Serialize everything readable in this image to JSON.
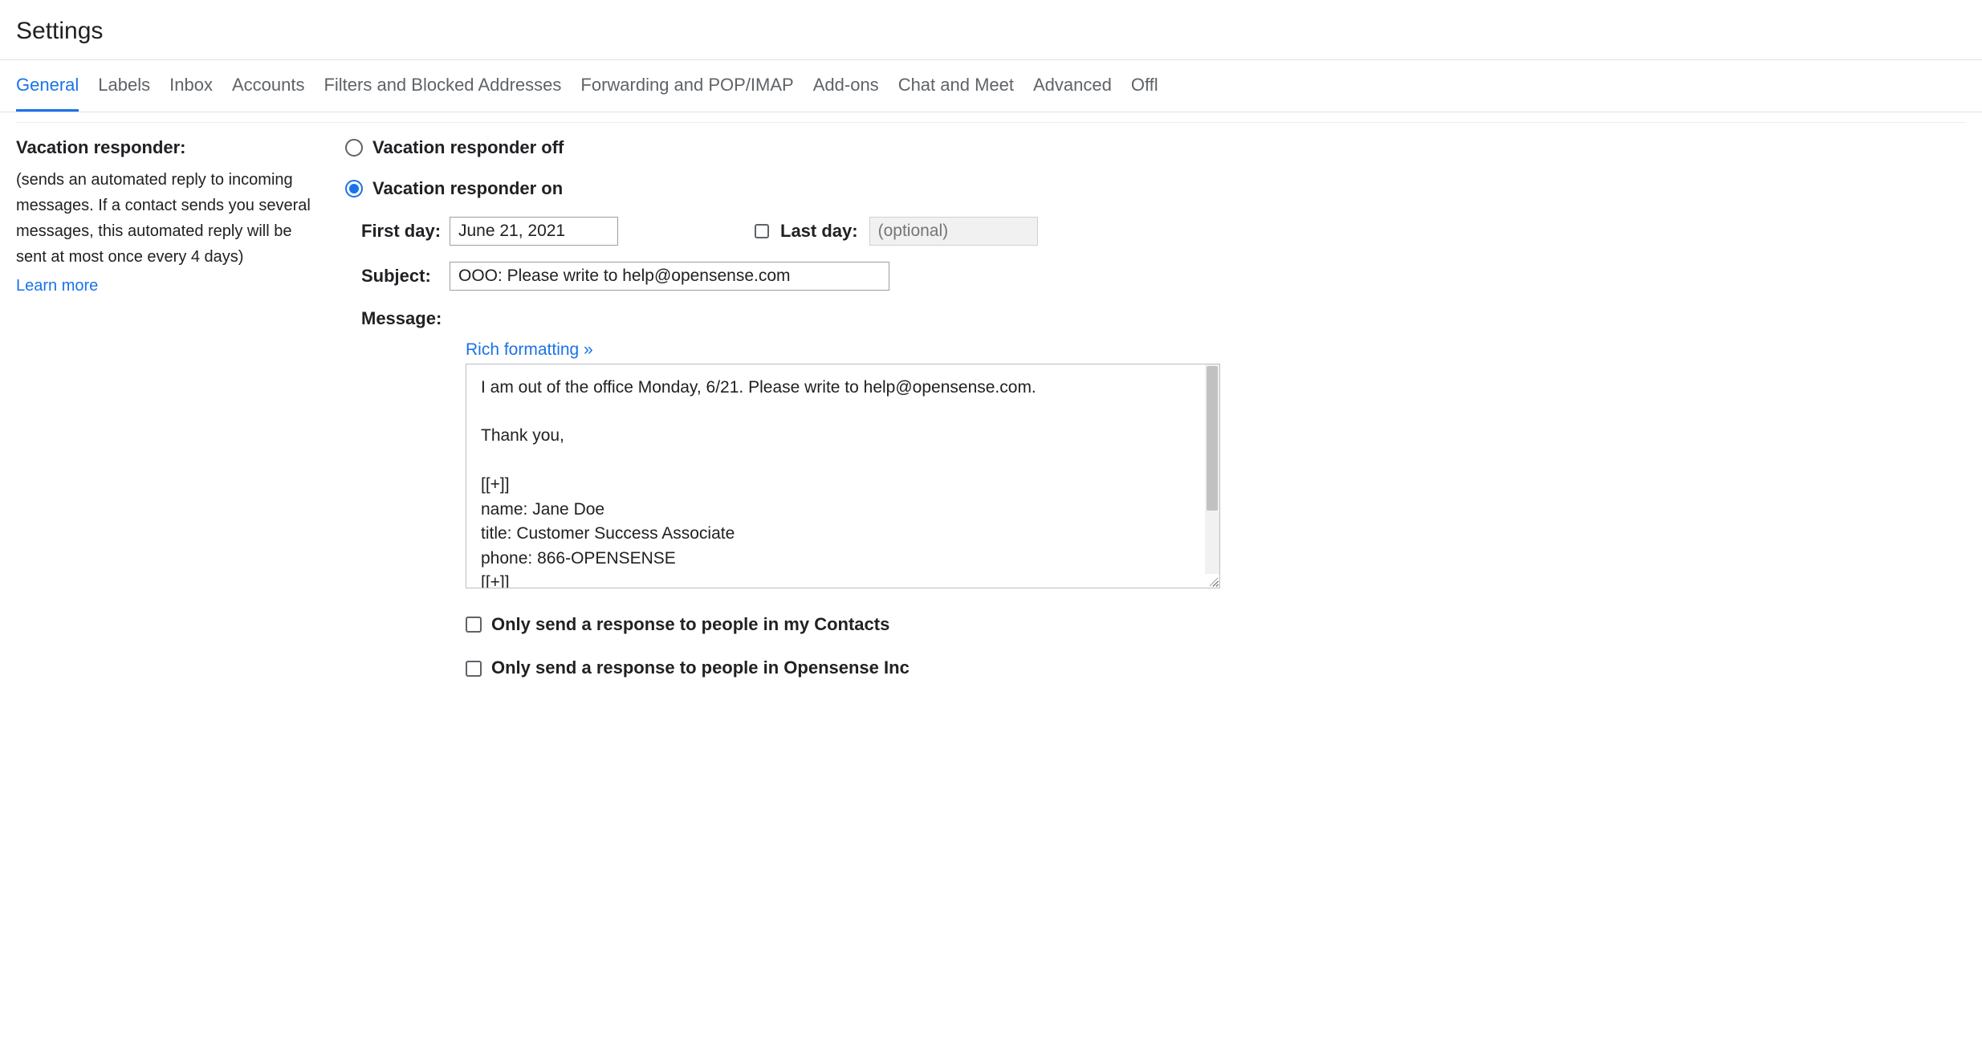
{
  "header": {
    "title": "Settings"
  },
  "tabs": {
    "items": [
      "General",
      "Labels",
      "Inbox",
      "Accounts",
      "Filters and Blocked Addresses",
      "Forwarding and POP/IMAP",
      "Add-ons",
      "Chat and Meet",
      "Advanced",
      "Offl"
    ],
    "active_index": 0
  },
  "sidebar": {
    "title": "Vacation responder:",
    "description": "(sends an automated reply to incoming messages. If a contact sends you several messages, this automated reply will be sent at most once every 4 days)",
    "learn_more": "Learn more"
  },
  "responder": {
    "off_label": "Vacation responder off",
    "on_label": "Vacation responder on",
    "selected": "on",
    "first_day_label": "First day:",
    "first_day_value": "June 21, 2021",
    "last_day_label": "Last day:",
    "last_day_placeholder": "(optional)",
    "last_day_checked": false,
    "subject_label": "Subject:",
    "subject_value": "OOO: Please write to help@opensense.com",
    "message_label": "Message:",
    "rich_formatting_label": "Rich formatting »",
    "message_body": "I am out of the office Monday, 6/21. Please write to help@opensense.com.\n\nThank you,\n\n[[+]]\nname: Jane Doe\ntitle: Customer Success Associate\nphone: 866-OPENSENSE\n[[+]]",
    "only_contacts_label": "Only send a response to people in my Contacts",
    "only_contacts_checked": false,
    "only_domain_label": "Only send a response to people in Opensense Inc",
    "only_domain_checked": false
  }
}
